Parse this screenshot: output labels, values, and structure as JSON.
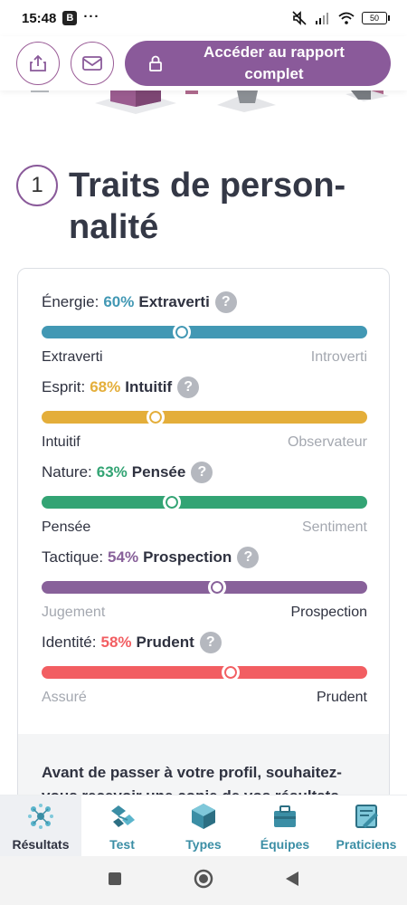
{
  "status_bar": {
    "time": "15:48",
    "badge": "B",
    "dots": "···",
    "battery": "50"
  },
  "action_bar": {
    "cta_label": "Accéder au rapport complet"
  },
  "section": {
    "number": "1",
    "title": "Traits de person-nalité"
  },
  "traits": [
    {
      "name": "Énergie:",
      "percent": "60%",
      "side": "Extraverti",
      "color": "#4298b4",
      "left_label": "Extraverti",
      "right_label": "Introverti",
      "active": "left",
      "knob_position": 0.43
    },
    {
      "name": "Esprit:",
      "percent": "68%",
      "side": "Intuitif",
      "color": "#e4ae3a",
      "left_label": "Intuitif",
      "right_label": "Observateur",
      "active": "left",
      "knob_position": 0.35
    },
    {
      "name": "Nature:",
      "percent": "63%",
      "side": "Pensée",
      "color": "#33a474",
      "left_label": "Pensée",
      "right_label": "Sentiment",
      "active": "left",
      "knob_position": 0.4
    },
    {
      "name": "Tactique:",
      "percent": "54%",
      "side": "Prospection",
      "color": "#88619a",
      "left_label": "Jugement",
      "right_label": "Prospection",
      "active": "right",
      "knob_position": 0.54
    },
    {
      "name": "Identité:",
      "percent": "58%",
      "side": "Prudent",
      "color": "#f25e62",
      "left_label": "Assuré",
      "right_label": "Prudent",
      "active": "right",
      "knob_position": 0.58
    }
  ],
  "card_footer": {
    "text": "Avant de passer à votre profil, souhaitez-vous recevoir une copie de vos résultats"
  },
  "bottom_nav": [
    {
      "label": "Résultats",
      "icon": "results-icon",
      "active": true
    },
    {
      "label": "Test",
      "icon": "test-icon",
      "active": false
    },
    {
      "label": "Types",
      "icon": "types-icon",
      "active": false
    },
    {
      "label": "Équipes",
      "icon": "teams-icon",
      "active": false
    },
    {
      "label": "Praticiens",
      "icon": "practitioners-icon",
      "active": false
    }
  ],
  "help_mark": "?"
}
